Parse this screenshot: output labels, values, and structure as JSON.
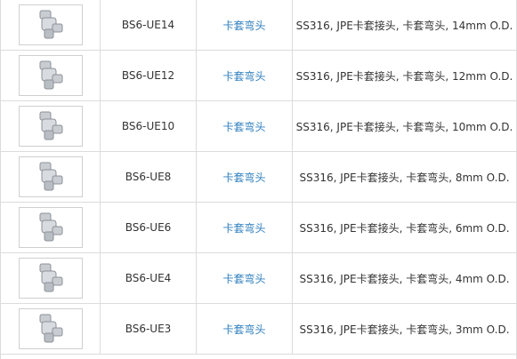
{
  "rows": [
    {
      "code": "BS6-UE14",
      "name": "卡套弯头",
      "desc": "SS316, JPE卡套接头, 卡套弯头, 14mm O.D."
    },
    {
      "code": "BS6-UE12",
      "name": "卡套弯头",
      "desc": "SS316, JPE卡套接头, 卡套弯头, 12mm O.D."
    },
    {
      "code": "BS6-UE10",
      "name": "卡套弯头",
      "desc": "SS316, JPE卡套接头, 卡套弯头, 10mm O.D."
    },
    {
      "code": "BS6-UE8",
      "name": "卡套弯头",
      "desc": "SS316, JPE卡套接头, 卡套弯头, 8mm O.D."
    },
    {
      "code": "BS6-UE6",
      "name": "卡套弯头",
      "desc": "SS316, JPE卡套接头, 卡套弯头, 6mm O.D."
    },
    {
      "code": "BS6-UE4",
      "name": "卡套弯头",
      "desc": "SS316, JPE卡套接头, 卡套弯头, 4mm O.D."
    },
    {
      "code": "BS6-UE3",
      "name": "卡套弯头",
      "desc": "SS316, JPE卡套接头, 卡套弯头, 3mm O.D."
    }
  ],
  "colors": {
    "link": "#2f7fbf",
    "text": "#333333",
    "border": "#dcdcdc"
  },
  "icons": {
    "thumbnail": "union-elbow-fitting-image"
  }
}
